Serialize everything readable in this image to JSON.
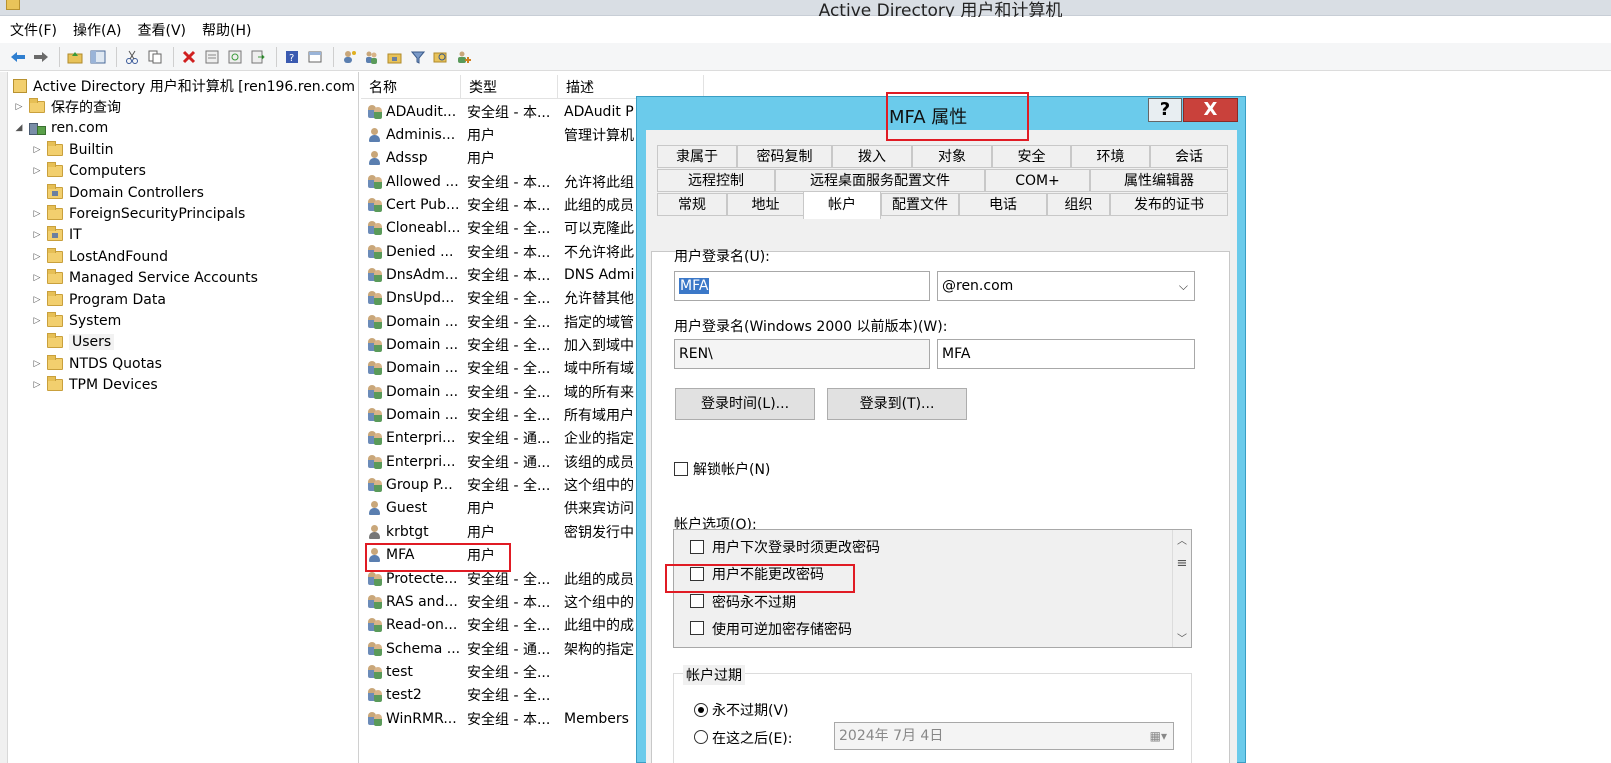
{
  "window": {
    "title": "Active Directory 用户和计算机"
  },
  "menu": [
    "文件(F)",
    "操作(A)",
    "查看(V)",
    "帮助(H)"
  ],
  "toolbar": {
    "icons": [
      "back-arrow-icon",
      "forward-arrow-icon",
      "up-folder-icon",
      "show-tree-icon",
      "cut-icon",
      "copy-icon",
      "delete-icon",
      "properties-icon",
      "refresh-icon",
      "export-icon",
      "help-icon",
      "console-icon",
      "new-user-icon",
      "new-group-icon",
      "new-ou-icon",
      "filter-icon",
      "find-icon",
      "add-to-group-icon"
    ]
  },
  "tree": {
    "root": "Active Directory 用户和计算机 [ren196.ren.com",
    "saved_queries": "保存的查询",
    "domain": "ren.com",
    "items": [
      "Builtin",
      "Computers",
      "Domain Controllers",
      "ForeignSecurityPrincipals",
      "IT",
      "LostAndFound",
      "Managed Service Accounts",
      "Program Data",
      "System",
      "Users",
      "NTDS Quotas",
      "TPM Devices"
    ]
  },
  "list": {
    "columns": [
      "名称",
      "类型",
      "描述"
    ],
    "rows": [
      {
        "name": "ADAudit...",
        "type": "安全组 - 本...",
        "desc": "ADAudit P",
        "icon": "group"
      },
      {
        "name": "Adminis...",
        "type": "用户",
        "desc": "管理计算机",
        "icon": "user"
      },
      {
        "name": "Adssp",
        "type": "用户",
        "desc": "",
        "icon": "user"
      },
      {
        "name": "Allowed ...",
        "type": "安全组 - 本...",
        "desc": "允许将此组",
        "icon": "group"
      },
      {
        "name": "Cert Pub...",
        "type": "安全组 - 本...",
        "desc": "此组的成员",
        "icon": "group"
      },
      {
        "name": "Cloneabl...",
        "type": "安全组 - 全...",
        "desc": "可以克隆此",
        "icon": "group"
      },
      {
        "name": "Denied ...",
        "type": "安全组 - 本...",
        "desc": "不允许将此",
        "icon": "group"
      },
      {
        "name": "DnsAdm...",
        "type": "安全组 - 本...",
        "desc": "DNS Admi",
        "icon": "group"
      },
      {
        "name": "DnsUpd...",
        "type": "安全组 - 全...",
        "desc": "允许替其他",
        "icon": "group"
      },
      {
        "name": "Domain ...",
        "type": "安全组 - 全...",
        "desc": "指定的域管",
        "icon": "group"
      },
      {
        "name": "Domain ...",
        "type": "安全组 - 全...",
        "desc": "加入到域中",
        "icon": "group"
      },
      {
        "name": "Domain ...",
        "type": "安全组 - 全...",
        "desc": "域中所有域",
        "icon": "group"
      },
      {
        "name": "Domain ...",
        "type": "安全组 - 全...",
        "desc": "域的所有来",
        "icon": "group"
      },
      {
        "name": "Domain ...",
        "type": "安全组 - 全...",
        "desc": "所有域用户",
        "icon": "group"
      },
      {
        "name": "Enterpri...",
        "type": "安全组 - 通...",
        "desc": "企业的指定",
        "icon": "group"
      },
      {
        "name": "Enterpri...",
        "type": "安全组 - 通...",
        "desc": "该组的成员",
        "icon": "group"
      },
      {
        "name": "Group P...",
        "type": "安全组 - 全...",
        "desc": "这个组中的",
        "icon": "group"
      },
      {
        "name": "Guest",
        "type": "用户",
        "desc": "供来宾访问",
        "icon": "user"
      },
      {
        "name": "krbtgt",
        "type": "用户",
        "desc": "密钥发行中",
        "icon": "user-disabled"
      },
      {
        "name": "MFA",
        "type": "用户",
        "desc": "",
        "icon": "user"
      },
      {
        "name": "Protecte...",
        "type": "安全组 - 全...",
        "desc": "此组的成员",
        "icon": "group"
      },
      {
        "name": "RAS and...",
        "type": "安全组 - 本...",
        "desc": "这个组中的",
        "icon": "group"
      },
      {
        "name": "Read-on...",
        "type": "安全组 - 全...",
        "desc": "此组中的成",
        "icon": "group"
      },
      {
        "name": "Schema ...",
        "type": "安全组 - 通...",
        "desc": "架构的指定",
        "icon": "group"
      },
      {
        "name": "test",
        "type": "安全组 - 全...",
        "desc": "",
        "icon": "group"
      },
      {
        "name": "test2",
        "type": "安全组 - 全...",
        "desc": "",
        "icon": "group"
      },
      {
        "name": "WinRMR...",
        "type": "安全组 - 本...",
        "desc": "Members",
        "icon": "group"
      }
    ]
  },
  "dialog": {
    "title": "MFA 属性",
    "help": "?",
    "close": "X",
    "tabs_row1": [
      "隶属于",
      "密码复制",
      "拨入",
      "对象",
      "安全",
      "环境",
      "会话"
    ],
    "tabs_row2": [
      "远程控制",
      "远程桌面服务配置文件",
      "COM+",
      "属性编辑器"
    ],
    "tabs_row3": [
      "常规",
      "地址",
      "帐户",
      "配置文件",
      "电话",
      "组织",
      "发布的证书"
    ],
    "active_tab": "帐户",
    "logon_name_label": "用户登录名(U):",
    "logon_name": "MFA",
    "upn_suffix": "@ren.com",
    "pre2000_label": "用户登录名(Windows 2000 以前版本)(W):",
    "pre2000_domain": "REN\\",
    "pre2000_name": "MFA",
    "logon_hours_btn": "登录时间(L)...",
    "logon_to_btn": "登录到(T)...",
    "unlock_label": "解锁帐户(N)",
    "options_label": "帐户选项(O):",
    "options": [
      "用户下次登录时须更改密码",
      "用户不能更改密码",
      "密码永不过期",
      "使用可逆加密存储密码"
    ],
    "expire_label": "帐户过期",
    "never_expire": "永不过期(V)",
    "expire_after": "在这之后(E):",
    "expire_date": "2024年  7月  4日"
  }
}
